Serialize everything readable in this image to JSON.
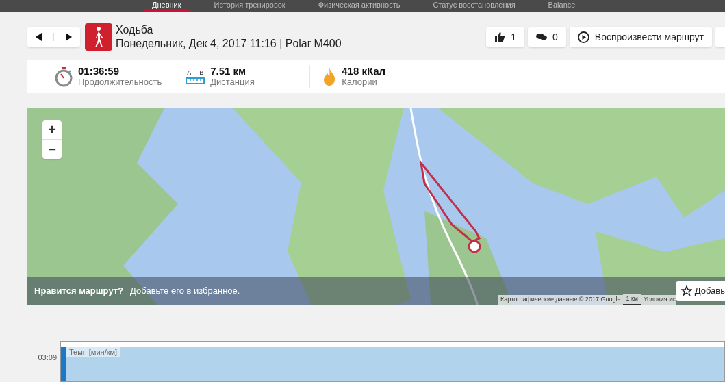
{
  "nav": {
    "tabs": [
      {
        "label": "Дневник",
        "selected": true
      },
      {
        "label": "История тренировок",
        "selected": false
      },
      {
        "label": "Физическая активность",
        "selected": false
      },
      {
        "label": "Статус восстановления",
        "selected": false
      },
      {
        "label": "Balance",
        "selected": false
      }
    ]
  },
  "header": {
    "sport": "Ходьба",
    "subtitle": "Понедельник, Дек 4, 2017 11:16 | Polar M400",
    "likes": "1",
    "comments": "0",
    "replay": "Воспроизвести маршрут"
  },
  "stats": [
    {
      "kind": "duration",
      "value": "01:36:59",
      "label": "Продолжительность"
    },
    {
      "kind": "distance",
      "value": "7.51 км",
      "label": "Дистанция",
      "a": "A",
      "b": "B"
    },
    {
      "kind": "calories",
      "value": "418 кКал",
      "label": "Калории"
    }
  ],
  "map": {
    "zoom_in": "+",
    "zoom_out": "−",
    "banner_question": "Нравится маршрут?",
    "banner_text": "Добавьте его в избранное.",
    "favorite_button": "Добавь",
    "attribution": "Картографические данные © 2017 Google",
    "scale": "1 км",
    "terms": "Условия ис"
  },
  "chart": {
    "legend": "Темп [мин/км]",
    "tick": "03:09"
  }
}
